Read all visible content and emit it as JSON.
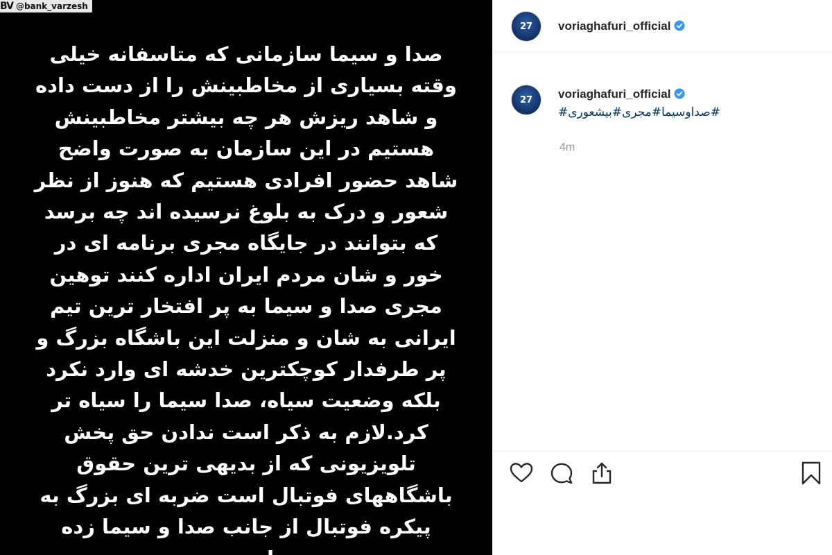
{
  "watermark": {
    "logo": "BV",
    "handle": "@bank_varzesh"
  },
  "story": {
    "lines": [
      "صدا و سیما سازمانی که متاسفانه خیلی",
      "وقته بسیاری از مخاطبینش را از دست داده",
      "و شاهد ریزش هر چه بیشتر مخاطبینش",
      "هستیم در این  سازمان به صورت واضح",
      "شاهد حضور افرادی هستیم که هنوز از نظر",
      "شعور و درک به بلوغ نرسیده اند چه برسد",
      "که بتوانند در جایگاه مجری برنامه ای در",
      "خور و شان مردم ایران اداره کنند توهین",
      "مجری صدا و سیما به پر افتخار ترین تیم",
      "ایرانی به شان و منزلت این باشگاه بزرگ و",
      "پر طرفدار کوچکترین خدشه ای وارد نکرد",
      "بلکه وضعیت سیاه، صدا سیما را سیاه تر",
      "کرد.لازم به ذکر است  ندادن حق پخش",
      "تلویزیونی که از بدیهی ترین حقوق",
      "باشگاههای فوتبال است ضربه ای بزرگ به",
      "پیکره فوتبال از جانب صدا و سیما زده",
      "است."
    ]
  },
  "header": {
    "username": "voriaghafuri_official",
    "avatar_number": "27"
  },
  "caption": {
    "username": "voriaghafuri_official",
    "avatar_number": "27",
    "hashtags": "#صداوسیما#مجری#بیشعوری#",
    "time": "4m"
  },
  "icons": {
    "verified": "verified-badge-icon",
    "like": "heart-icon",
    "comment": "comment-icon",
    "share": "share-icon",
    "save": "bookmark-icon"
  },
  "colors": {
    "verified": "#3897f0",
    "hashtag": "#003569",
    "muted": "#999999",
    "text": "#262626"
  }
}
